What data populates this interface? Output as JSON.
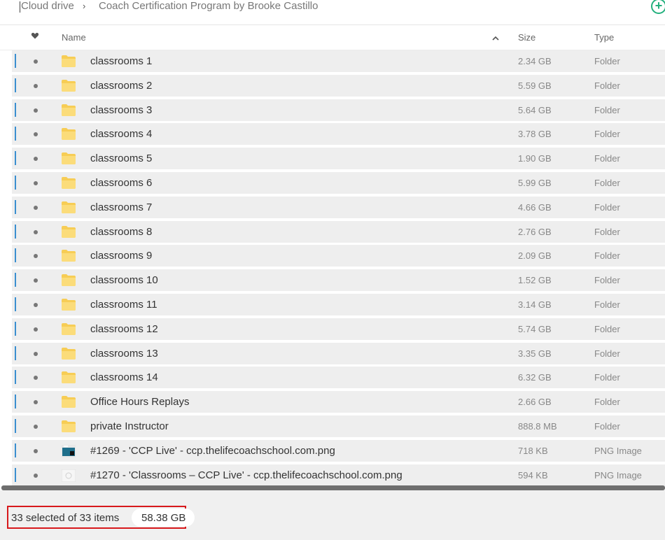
{
  "breadcrumb": {
    "root": "Cloud drive",
    "separator": "›",
    "current": "Coach Certification Program by Brooke Castillo"
  },
  "toolbar": {
    "add_icon": "plus-circle-icon",
    "accent": "#23b07d"
  },
  "columns": {
    "name": "Name",
    "size": "Size",
    "type": "Type",
    "sort_icon": "chevron-up-icon",
    "favorite_icon": "heart-icon"
  },
  "files": [
    {
      "name": "classrooms 1",
      "size": "2.34 GB",
      "type": "Folder",
      "icon": "folder-icon"
    },
    {
      "name": "classrooms 2",
      "size": "5.59 GB",
      "type": "Folder",
      "icon": "folder-icon"
    },
    {
      "name": "classrooms 3",
      "size": "5.64 GB",
      "type": "Folder",
      "icon": "folder-icon"
    },
    {
      "name": "classrooms 4",
      "size": "3.78 GB",
      "type": "Folder",
      "icon": "folder-icon"
    },
    {
      "name": "classrooms 5",
      "size": "1.90 GB",
      "type": "Folder",
      "icon": "folder-icon"
    },
    {
      "name": "classrooms 6",
      "size": "5.99 GB",
      "type": "Folder",
      "icon": "folder-icon"
    },
    {
      "name": "classrooms 7",
      "size": "4.66 GB",
      "type": "Folder",
      "icon": "folder-icon"
    },
    {
      "name": "classrooms 8",
      "size": "2.76 GB",
      "type": "Folder",
      "icon": "folder-icon"
    },
    {
      "name": "classrooms 9",
      "size": "2.09 GB",
      "type": "Folder",
      "icon": "folder-icon"
    },
    {
      "name": "classrooms 10",
      "size": "1.52 GB",
      "type": "Folder",
      "icon": "folder-icon"
    },
    {
      "name": "classrooms 11",
      "size": "3.14 GB",
      "type": "Folder",
      "icon": "folder-icon"
    },
    {
      "name": "classrooms 12",
      "size": "5.74 GB",
      "type": "Folder",
      "icon": "folder-icon"
    },
    {
      "name": "classrooms 13",
      "size": "3.35 GB",
      "type": "Folder",
      "icon": "folder-icon"
    },
    {
      "name": "classrooms 14",
      "size": "6.32 GB",
      "type": "Folder",
      "icon": "folder-icon"
    },
    {
      "name": "Office Hours Replays",
      "size": "2.66 GB",
      "type": "Folder",
      "icon": "folder-icon"
    },
    {
      "name": "private Instructor",
      "size": "888.8 MB",
      "type": "Folder",
      "icon": "folder-icon"
    },
    {
      "name": "#1269 - 'CCP Live' - ccp.thelifecoachschool.com.png",
      "size": "718 KB",
      "type": "PNG Image",
      "icon": "image-thumbnail-icon"
    },
    {
      "name": "#1270 - 'Classrooms – CCP Live' - ccp.thelifecoachschool.com.png",
      "size": "594 KB",
      "type": "PNG Image",
      "icon": "image-thumbnail-icon"
    }
  ],
  "footer": {
    "selection": "33 selected of 33 items",
    "total_size": "58.38 GB",
    "highlight_color": "#d7191c"
  },
  "colors": {
    "folder": "#f7cd55",
    "row_bg": "#eeeeee",
    "row_marker": "#3b8fd0"
  }
}
